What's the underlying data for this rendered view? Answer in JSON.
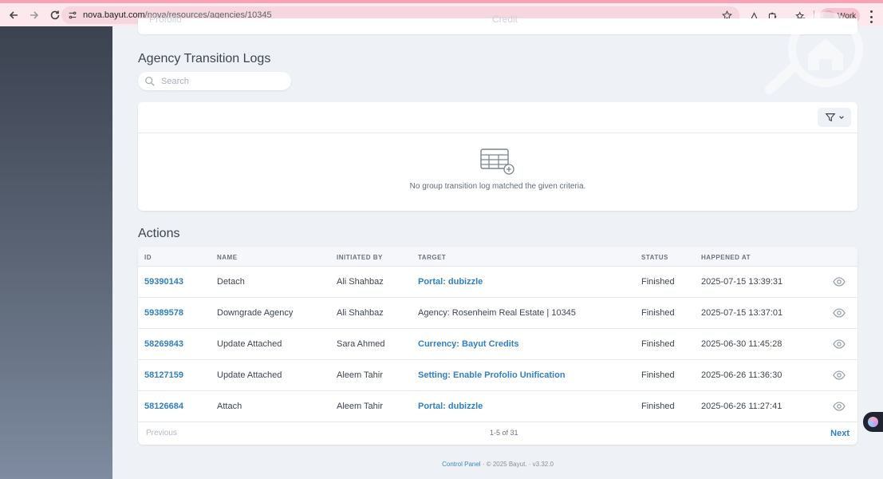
{
  "browser": {
    "url_host": "nova.bayut.com",
    "url_path": "/nova/resources/agencies/10345",
    "profile_label": "Work"
  },
  "top_card": {
    "left_text": "Profolio",
    "right_text": "Credit"
  },
  "transition_logs": {
    "title": "Agency Transition Logs",
    "search_placeholder": "Search",
    "empty_message": "No group transition log matched the given criteria."
  },
  "actions": {
    "title": "Actions",
    "columns": [
      "ID",
      "NAME",
      "INITIATED BY",
      "TARGET",
      "STATUS",
      "HAPPENED AT"
    ],
    "rows": [
      {
        "id": "59390143",
        "name": "Detach",
        "initiated_by": "Ali Shahbaz",
        "target": "Portal: dubizzle",
        "target_link": true,
        "status": "Finished",
        "happened_at": "2025-07-15 13:39:31"
      },
      {
        "id": "59389578",
        "name": "Downgrade Agency",
        "initiated_by": "Ali Shahbaz",
        "target": "Agency: Rosenheim Real Estate | 10345",
        "target_link": false,
        "status": "Finished",
        "happened_at": "2025-07-15 13:37:01"
      },
      {
        "id": "58269843",
        "name": "Update Attached",
        "initiated_by": "Sara Ahmed",
        "target": "Currency: Bayut Credits",
        "target_link": true,
        "status": "Finished",
        "happened_at": "2025-06-30 11:45:28"
      },
      {
        "id": "58127159",
        "name": "Update Attached",
        "initiated_by": "Aleem Tahir",
        "target": "Setting: Enable Profolio Unification",
        "target_link": true,
        "status": "Finished",
        "happened_at": "2025-06-26 11:36:30"
      },
      {
        "id": "58126684",
        "name": "Attach",
        "initiated_by": "Aleem Tahir",
        "target": "Portal: dubizzle",
        "target_link": true,
        "status": "Finished",
        "happened_at": "2025-06-26 11:27:41"
      }
    ],
    "pagination": {
      "previous": "Previous",
      "range": "1-5 of 31",
      "next": "Next"
    }
  },
  "footer": {
    "link": "Control Panel",
    "copyright": "© 2025 Bayut.",
    "version": "v3.32.0"
  },
  "colors": {
    "accent": "#2f7fc1",
    "chrome_bar": "#fde8ee",
    "sidebar_top": "#3b4250"
  }
}
